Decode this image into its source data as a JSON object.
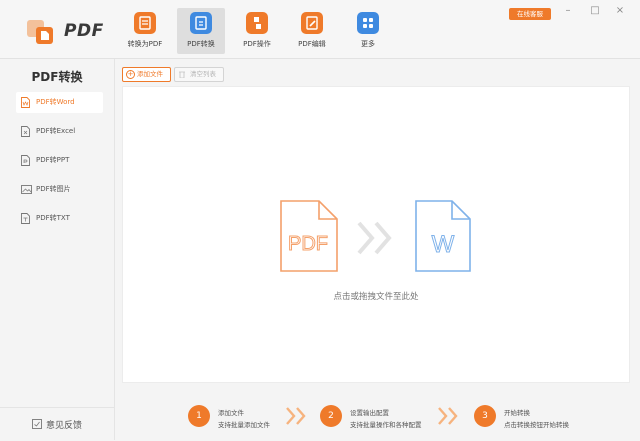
{
  "app": {
    "logo_text": "PDF",
    "brand_color": "#ef7a2a",
    "support_button": "在线客服",
    "window_controls": [
      "–",
      "□",
      "×"
    ]
  },
  "toolbar": {
    "items": [
      {
        "label": "转换为PDF",
        "icon": "convert-to-pdf-icon",
        "active": false
      },
      {
        "label": "PDF转换",
        "icon": "pdf-convert-icon",
        "active": true
      },
      {
        "label": "PDF操作",
        "icon": "pdf-operations-icon",
        "active": false
      },
      {
        "label": "PDF编辑",
        "icon": "pdf-edit-icon",
        "active": false
      },
      {
        "label": "更多",
        "icon": "more-grid-icon",
        "active": false
      }
    ]
  },
  "sidebar": {
    "title": "PDF转换",
    "items": [
      {
        "label": "PDF转Word",
        "icon": "word-file-icon",
        "active": true
      },
      {
        "label": "PDF转Excel",
        "icon": "excel-file-icon",
        "active": false
      },
      {
        "label": "PDF转PPT",
        "icon": "ppt-file-icon",
        "active": false
      },
      {
        "label": "PDF转图片",
        "icon": "image-file-icon",
        "active": false
      },
      {
        "label": "PDF转TXT",
        "icon": "txt-file-icon",
        "active": false
      }
    ],
    "feedback_label": "意见反馈"
  },
  "actions": {
    "add_file": "添加文件",
    "clear_list": "清空列表"
  },
  "dropzone": {
    "source_label": "PDF",
    "target_label": "W",
    "hint": "点击或拖拽文件至此处"
  },
  "steps": [
    {
      "num": "1",
      "title": "添加文件",
      "desc": "支持批量添加文件"
    },
    {
      "num": "2",
      "title": "设置输出配置",
      "desc": "支持批量操作和各种配置"
    },
    {
      "num": "3",
      "title": "开始转换",
      "desc": "点击转换按钮开始转换"
    }
  ]
}
